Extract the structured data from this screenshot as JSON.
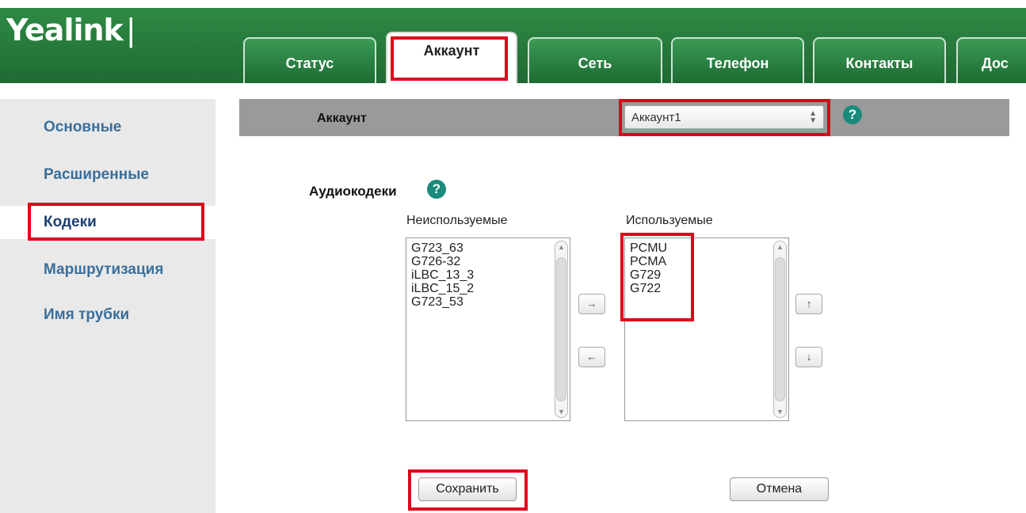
{
  "header": {
    "logo": "Yealink",
    "logo_bar": "|",
    "tabs": [
      {
        "label": "Статус"
      },
      {
        "label": "Аккаунт"
      },
      {
        "label": "Сеть"
      },
      {
        "label": "Телефон"
      },
      {
        "label": "Контакты"
      },
      {
        "label": "Дос"
      }
    ],
    "active_tab": "Аккаунт"
  },
  "sidebar": {
    "items": [
      {
        "label": "Основные"
      },
      {
        "label": "Расширенные"
      },
      {
        "label": "Кодеки"
      },
      {
        "label": "Маршрутизация"
      },
      {
        "label": "Имя трубки"
      }
    ],
    "active_item": "Кодеки"
  },
  "account_row": {
    "label": "Аккаунт",
    "selected": "Аккаунт1",
    "help": "?"
  },
  "codecs": {
    "section_label": "Аудиокодеки",
    "help": "?",
    "unused_label": "Неиспользуемые",
    "used_label": "Используемые",
    "unused": [
      "G723_63",
      "G726-32",
      "iLBC_13_3",
      "iLBC_15_2",
      "G723_53"
    ],
    "used": [
      "PCMU",
      "PCMA",
      "G729",
      "G722"
    ],
    "move_right": "→",
    "move_left": "←",
    "move_up": "↑",
    "move_down": "↓"
  },
  "actions": {
    "save": "Сохранить",
    "cancel": "Отмена"
  },
  "colors": {
    "highlight": "#e0001b",
    "header_green": "#2b7a3c"
  }
}
